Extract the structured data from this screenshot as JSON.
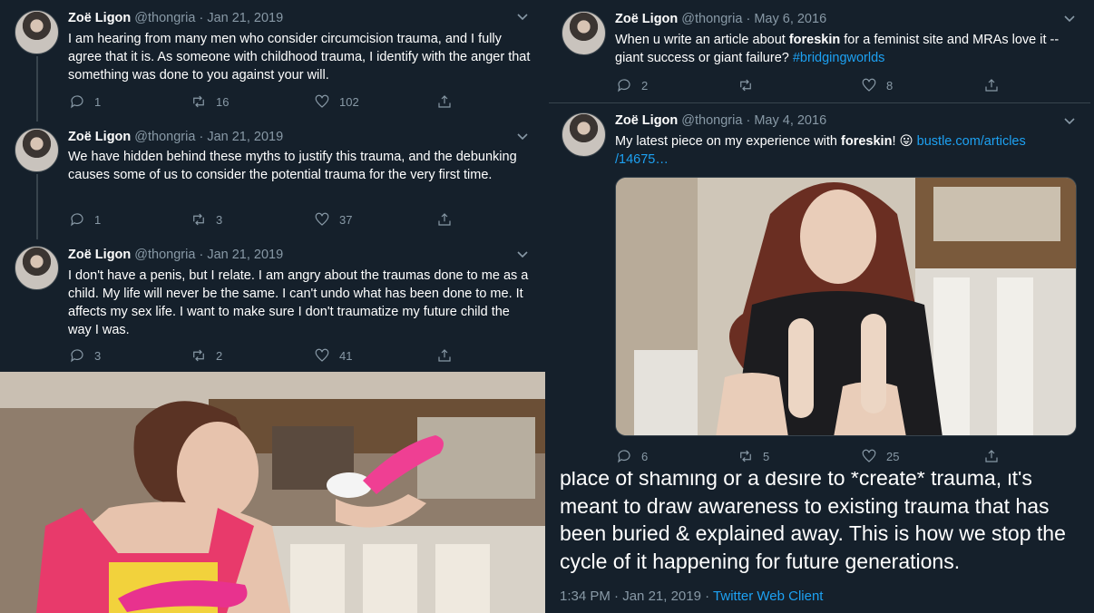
{
  "left_thread": {
    "tweets": [
      {
        "name": "Zoë Ligon",
        "handle": "@thongria",
        "sep": "·",
        "date": "Jan 21, 2019",
        "text": "I am hearing from many men who consider circumcision trauma, and I fully agree that it is. As someone with childhood trauma, I identify with the anger that something was done to you against your will.",
        "replies": "1",
        "retweets": "16",
        "likes": "102"
      },
      {
        "name": "Zoë Ligon",
        "handle": "@thongria",
        "sep": "·",
        "date": "Jan 21, 2019",
        "text": "We have hidden behind these myths to justify this trauma, and the debunking causes some of us to consider the potential trauma for the very first time.",
        "replies": "1",
        "retweets": "3",
        "likes": "37"
      },
      {
        "name": "Zoë Ligon",
        "handle": "@thongria",
        "sep": "·",
        "date": "Jan 21, 2019",
        "text": "I don't have a penis, but I relate. I am angry about the traumas done to me as a child. My life will never be the same. I can't undo what has been done to me. It affects my sex life. I want to make sure I don't traumatize my future child the way I was.",
        "replies": "3",
        "retweets": "2",
        "likes": "41"
      }
    ]
  },
  "right_tweets": {
    "tweet_a": {
      "name": "Zoë Ligon",
      "handle": "@thongria",
      "sep": "·",
      "date": "May 6, 2016",
      "text_pre": "When u write an article about ",
      "text_bold": "foreskin",
      "text_post": " for a feminist site and MRAs love it -- giant success or giant failure? ",
      "hashtag": "#bridgingworlds",
      "replies": "2",
      "likes": "8"
    },
    "tweet_b": {
      "name": "Zoë Ligon",
      "handle": "@thongria",
      "sep": "·",
      "date": "May 4, 2016",
      "text_pre": "My latest piece on my experience with ",
      "text_bold": "foreskin",
      "text_post": "! 😛 ",
      "link_line1": "bustle.com/articles",
      "link_line2": "/14675…",
      "replies": "6",
      "retweets": "5",
      "likes": "25"
    }
  },
  "detail_tweet": {
    "lines": [
      "place of shaming or a desire to *create* trauma, it's",
      "meant to draw awareness to existing trauma that has",
      "been buried & explained away. This is how we stop the",
      "cycle of it happening for future generations."
    ],
    "time": "1:34 PM",
    "sep": "·",
    "date": "Jan 21, 2019",
    "client": "Twitter Web Client"
  },
  "colors": {
    "background": "#15202b",
    "divider": "#38444d",
    "muted": "#8899a6",
    "link": "#1da1f2"
  },
  "icons": [
    "chevron-down-icon",
    "reply-icon",
    "retweet-icon",
    "like-icon",
    "share-icon"
  ]
}
